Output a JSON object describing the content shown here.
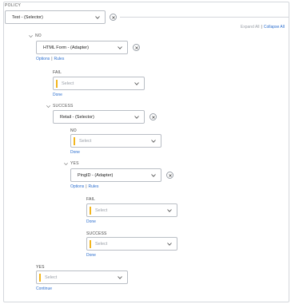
{
  "policy": {
    "label": "POLICY",
    "selector": "Test - (Selector)",
    "expand_all": "Expand All",
    "separator": "|",
    "collapse_all": "Collapse All"
  },
  "no_branch": {
    "label": "NO",
    "adapter": "HTML Form - (Adapter)",
    "options": "Options",
    "rules": "Rules",
    "fail": {
      "label": "FAIL",
      "placeholder": "Select",
      "done": "Done"
    },
    "success": {
      "label": "SUCCESS",
      "selector": "Retail - (Selector)",
      "no": {
        "label": "NO",
        "placeholder": "Select",
        "done": "Done"
      },
      "yes": {
        "label": "YES",
        "adapter": "PingID - (Adapter)",
        "options": "Options",
        "rules": "Rules",
        "fail": {
          "label": "FAIL",
          "placeholder": "Select",
          "done": "Done"
        },
        "success": {
          "label": "SUCCESS",
          "placeholder": "Select",
          "done": "Done"
        }
      }
    }
  },
  "yes_branch": {
    "label": "YES",
    "placeholder": "Select",
    "continue": "Continue"
  },
  "colors": {
    "accent": "#f2b51d",
    "link": "#2d6fcf",
    "border": "#b9bec5"
  },
  "icons": {
    "dropdown": "chevron-down-icon",
    "clear": "close-icon",
    "expand": "caret-down-icon"
  }
}
